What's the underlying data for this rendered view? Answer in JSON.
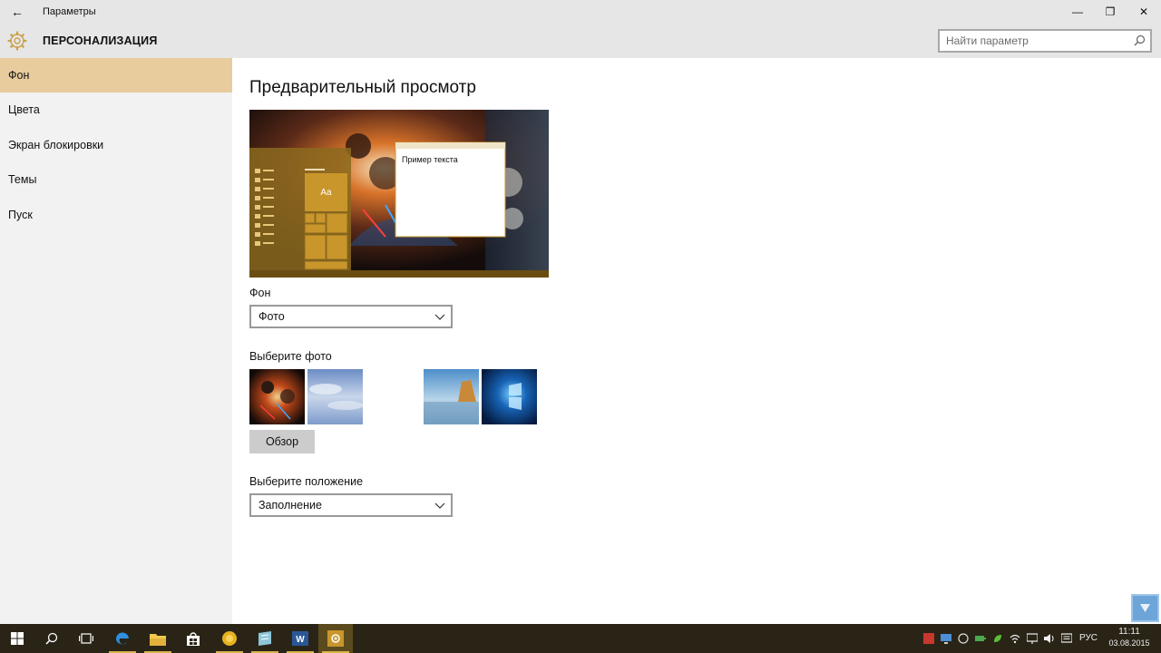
{
  "window": {
    "title": "Параметры",
    "back_glyph": "←",
    "minimize_glyph": "—",
    "maximize_glyph": "❐",
    "close_glyph": "✕"
  },
  "header": {
    "section_title": "ПЕРСОНАЛИЗАЦИЯ",
    "icon": "gear-icon",
    "search_placeholder": "Найти параметр"
  },
  "sidebar": {
    "items": [
      {
        "label": "Фон",
        "active": true
      },
      {
        "label": "Цвета",
        "active": false
      },
      {
        "label": "Экран блокировки",
        "active": false
      },
      {
        "label": "Темы",
        "active": false
      },
      {
        "label": "Пуск",
        "active": false
      }
    ]
  },
  "main": {
    "preview_heading": "Предварительный просмотр",
    "preview_sample_text": "Пример текста",
    "preview_tile_text": "Aa",
    "background_label": "Фон",
    "background_value": "Фото",
    "choose_photo_label": "Выберите фото",
    "browse_label": "Обзор",
    "position_label": "Выберите положение",
    "position_value": "Заполнение"
  },
  "taskbar": {
    "language": "РУС",
    "time": "11:11",
    "date": "03.08.2015",
    "apps": [
      "start-icon",
      "search-icon",
      "task-view-icon",
      "edge-icon",
      "file-explorer-icon",
      "store-icon",
      "yellow-app-icon",
      "notes-app-icon",
      "word-icon",
      "settings-icon"
    ]
  },
  "colors": {
    "accent": "#e8cc9e",
    "taskbar": "#2a2417",
    "titlebar": "#e6e6e6",
    "sidebar": "#f2f2f2",
    "preview_tile": "#c9962b"
  }
}
